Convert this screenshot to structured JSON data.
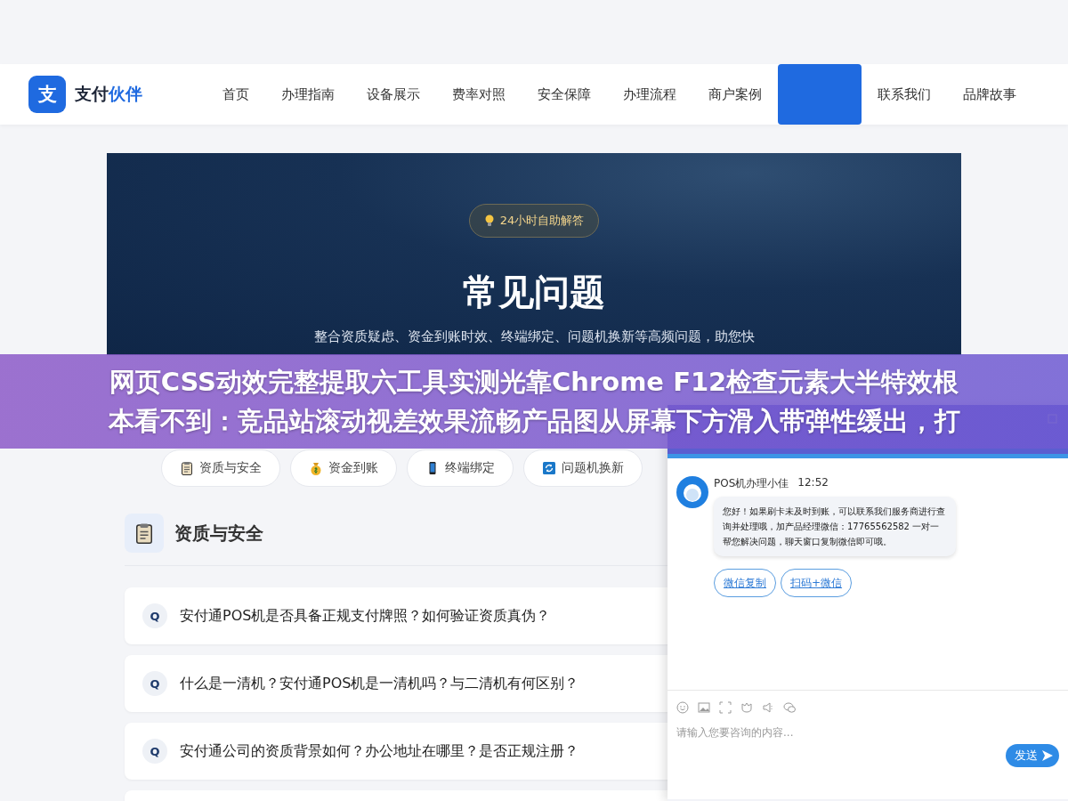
{
  "brand": {
    "logo": "支",
    "name": "支付",
    "accent": "伙伴"
  },
  "nav": {
    "items": [
      {
        "label": "首页",
        "selected": false
      },
      {
        "label": "办理指南",
        "selected": false
      },
      {
        "label": "设备展示",
        "selected": false
      },
      {
        "label": "费率对照",
        "selected": false
      },
      {
        "label": "安全保障",
        "selected": false
      },
      {
        "label": "办理流程",
        "selected": false
      },
      {
        "label": "商户案例",
        "selected": false
      },
      {
        "selected": true
      },
      {
        "label": "联系我们",
        "selected": false
      },
      {
        "label": "品牌故事",
        "selected": false
      }
    ]
  },
  "hero": {
    "badge": "24小时自助解答",
    "title": "常见问题",
    "subtitle": "整合资质疑虑、资金到账时效、终端绑定、问题机换新等高频问题，助您快"
  },
  "categories": [
    {
      "label": "资质与安全"
    },
    {
      "label": "资金到账"
    },
    {
      "label": "终端绑定"
    },
    {
      "label": "问题机换新"
    }
  ],
  "section": {
    "title": "资质与安全"
  },
  "questions": [
    {
      "mark": "Q",
      "text": "安付通POS机是否具备正规支付牌照？如何验证资质真伪？"
    },
    {
      "mark": "Q",
      "text": "什么是一清机？安付通POS机是一清机吗？与二清机有何区别？"
    },
    {
      "mark": "Q",
      "text": "安付通公司的资质背景如何？办公地址在哪里？是否正规注册？"
    }
  ],
  "chat": {
    "agent": "POS机办理小佳",
    "time": "12:52",
    "message": "您好！如果刷卡未及时到账，可以联系我们服务商进行查询并处理哦，加产品经理微信：17765562582 一对一帮您解决问题，聊天窗口复制微信即可哦。",
    "actions": [
      "微信复制",
      "扫码+微信"
    ],
    "placeholder": "请输入您要咨询的内容...",
    "send": "发送"
  },
  "caption": [
    "网页CSS动效完整提取六工具实测光靠Chrome F12检查元素大半特效根",
    "本看不到：竞品站滚动视差效果流畅产品图从屏幕下方滑入带弹性缓出，打"
  ]
}
